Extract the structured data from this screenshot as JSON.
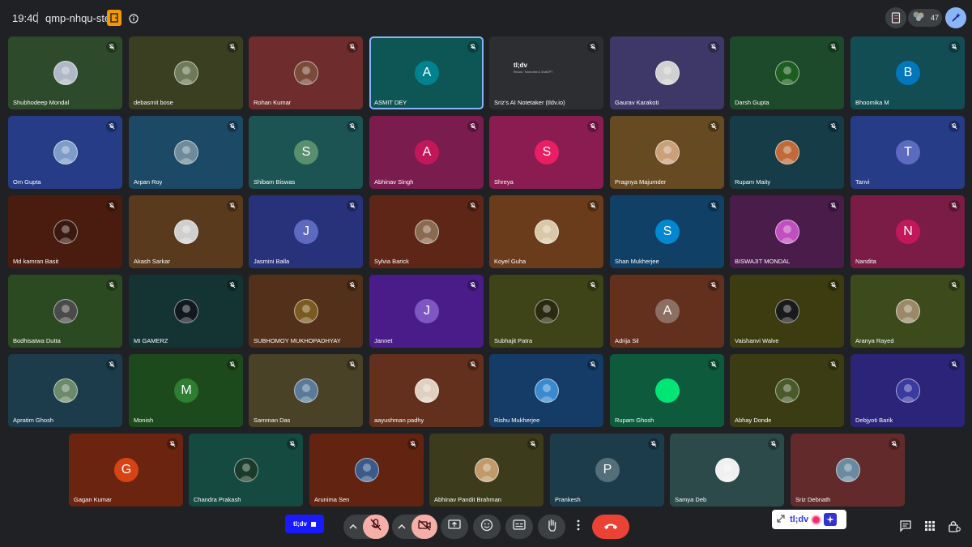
{
  "header": {
    "time": "19:40",
    "meeting_code": "qmp-nhqu-ste",
    "participant_count": "47",
    "icons": [
      "door-icon",
      "info-icon",
      "report-icon",
      "people-icon",
      "ai-sparkle-icon"
    ]
  },
  "participants": [
    {
      "name": "Shubhodeep Mondal",
      "bg": "#2d4a2a",
      "avatar": "photo",
      "avatar_color": "#b0b8c8"
    },
    {
      "name": "debasmit bose",
      "bg": "#3a3f22",
      "avatar": "photo",
      "avatar_color": "#6f7a5a"
    },
    {
      "name": "Rohan Kumar",
      "bg": "#6e2c2c",
      "avatar": "photo",
      "avatar_color": "#7a4a3a"
    },
    {
      "name": "ASMIT DEY",
      "bg": "#0e5555",
      "avatar": "letter",
      "initial": "A",
      "avatar_color": "#00838f",
      "active": true
    },
    {
      "name": "Sriz's AI Notetaker (tldv.io)",
      "bg": "#2d2e31",
      "avatar": "tldv",
      "tldv_logo": "tl;dv",
      "tldv_sub": "Record, Transcribe & ChatGPT"
    },
    {
      "name": "Gaurav Karakoti",
      "bg": "#3d3868",
      "avatar": "photo",
      "avatar_color": "#d0d0d0"
    },
    {
      "name": "Darsh Gupta",
      "bg": "#1e4a2c",
      "avatar": "photo",
      "avatar_color": "#1b5e20"
    },
    {
      "name": "Bhoomika M",
      "bg": "#114d52",
      "avatar": "letter",
      "initial": "B",
      "avatar_color": "#0277bd"
    },
    {
      "name": "Om Gupta",
      "bg": "#263c87",
      "avatar": "photo",
      "avatar_color": "#7f9cc8"
    },
    {
      "name": "Arpan Roy",
      "bg": "#1c4a66",
      "avatar": "photo",
      "avatar_color": "#6f8a9a"
    },
    {
      "name": "Shibam Biswas",
      "bg": "#1c5454",
      "avatar": "letter",
      "initial": "S",
      "avatar_color": "#598f6e"
    },
    {
      "name": "Abhinav Singh",
      "bg": "#7a1c4e",
      "avatar": "letter",
      "initial": "A",
      "avatar_color": "#c2185b"
    },
    {
      "name": "Shreya",
      "bg": "#8a1c52",
      "avatar": "letter",
      "initial": "S",
      "avatar_color": "#e91e63"
    },
    {
      "name": "Pragnya Majumder",
      "bg": "#654a22",
      "avatar": "photo",
      "avatar_color": "#c9a07a"
    },
    {
      "name": "Rupam Maity",
      "bg": "#153c47",
      "avatar": "photo",
      "avatar_color": "#c06a3a"
    },
    {
      "name": "Tanvi",
      "bg": "#263c87",
      "avatar": "letter",
      "initial": "T",
      "avatar_color": "#5c6bc0"
    },
    {
      "name": "Md kamran Basit",
      "bg": "#4a1c0f",
      "avatar": "photo",
      "avatar_color": "#3a1a10"
    },
    {
      "name": "Akash Sarkar",
      "bg": "#5a3a1c",
      "avatar": "photo",
      "avatar_color": "#cfcfcf"
    },
    {
      "name": "Jasmini Balla",
      "bg": "#28327a",
      "avatar": "letter",
      "initial": "J",
      "avatar_color": "#5c6bc0"
    },
    {
      "name": "Sylvia Barick",
      "bg": "#5e2616",
      "avatar": "photo",
      "avatar_color": "#8a6a50"
    },
    {
      "name": "Koyel Guha",
      "bg": "#6a3c1c",
      "avatar": "photo",
      "avatar_color": "#d8c8a8"
    },
    {
      "name": "Shan Mukherjee",
      "bg": "#114066",
      "avatar": "letter",
      "initial": "S",
      "avatar_color": "#0288d1"
    },
    {
      "name": "BISWAJIT MONDAL",
      "bg": "#4a1c4a",
      "avatar": "photo",
      "avatar_color": "#c050c0"
    },
    {
      "name": "Nandita",
      "bg": "#7a1c46",
      "avatar": "letter",
      "initial": "N",
      "avatar_color": "#c2185b"
    },
    {
      "name": "Bodhisatwa Dutta",
      "bg": "#2c4a22",
      "avatar": "photo",
      "avatar_color": "#4a4a4a"
    },
    {
      "name": "MI GAMERZ",
      "bg": "#143333",
      "avatar": "photo",
      "avatar_color": "#101820"
    },
    {
      "name": "SUBHOMOY MUKHOPADHYAY",
      "bg": "#52301a",
      "avatar": "photo",
      "avatar_color": "#7a5a20"
    },
    {
      "name": "Jannet",
      "bg": "#4a1c8a",
      "avatar": "letter",
      "initial": "J",
      "avatar_color": "#7e57c2"
    },
    {
      "name": "Subhajit Patra",
      "bg": "#3e4418",
      "avatar": "photo",
      "avatar_color": "#2a2a10"
    },
    {
      "name": "Adrija Sil",
      "bg": "#62301c",
      "avatar": "letter",
      "initial": "A",
      "avatar_color": "#8d6e63"
    },
    {
      "name": "Vaishanvi Walve",
      "bg": "#3c3c10",
      "avatar": "photo",
      "avatar_color": "#1a1a1a"
    },
    {
      "name": "Aranya Rayed",
      "bg": "#3c4a1c",
      "avatar": "photo",
      "avatar_color": "#9a8a6a"
    },
    {
      "name": "Apratim Ghosh",
      "bg": "#1c3c4c",
      "avatar": "photo",
      "avatar_color": "#6a8a6a"
    },
    {
      "name": "Monish",
      "bg": "#1c4a1c",
      "avatar": "letter",
      "initial": "M",
      "avatar_color": "#2e7d32"
    },
    {
      "name": "Samman Das",
      "bg": "#4a4226",
      "avatar": "photo",
      "avatar_color": "#5a7a9a"
    },
    {
      "name": "aayushman padhy",
      "bg": "#62301c",
      "avatar": "photo",
      "avatar_color": "#e0d0c0"
    },
    {
      "name": "Rishu Mukherjee",
      "bg": "#143c66",
      "avatar": "photo",
      "avatar_color": "#3a8ad0"
    },
    {
      "name": "Rupam Ghosh",
      "bg": "#0e5a3c",
      "avatar": "circle",
      "avatar_color": "#00e676"
    },
    {
      "name": "Abhay Donde",
      "bg": "#3c3c14",
      "avatar": "photo",
      "avatar_color": "#4a5a2a"
    },
    {
      "name": "Debjyoti Barik",
      "bg": "#2c2478",
      "avatar": "photo",
      "avatar_color": "#3a3aa0"
    },
    {
      "name": "Gagan Kumar",
      "bg": "#6a2410",
      "avatar": "letter",
      "initial": "G",
      "avatar_color": "#d84315"
    },
    {
      "name": "Chandra Prakash",
      "bg": "#144a40",
      "avatar": "photo",
      "avatar_color": "#1a3a2a"
    },
    {
      "name": "Arunima Sen",
      "bg": "#622410",
      "avatar": "photo",
      "avatar_color": "#3a5a8a"
    },
    {
      "name": "Abhinav Pandit Brahman",
      "bg": "#3c3c1c",
      "avatar": "photo",
      "avatar_color": "#c09a6a"
    },
    {
      "name": "Prankesh",
      "bg": "#1c3c4c",
      "avatar": "letter",
      "initial": "P",
      "avatar_color": "#546e7a"
    },
    {
      "name": "Samya Deb",
      "bg": "#2c4a4a",
      "avatar": "photo",
      "avatar_color": "#f0f0f0"
    },
    {
      "name": "Sriz Debnath",
      "bg": "#622a2a",
      "avatar": "photo",
      "avatar_color": "#6a8aa0"
    }
  ],
  "controls": {
    "tldv_chip": "tl;dv",
    "extension_label": "tl;dv",
    "icons": [
      "chevron-up-icon",
      "mic-off-icon",
      "camera-off-icon",
      "present-icon",
      "emoji-icon",
      "captions-icon",
      "raise-hand-icon",
      "more-icon",
      "end-call-icon",
      "chat-icon",
      "activities-icon",
      "host-controls-icon"
    ]
  },
  "colors": {
    "background": "#202124",
    "control": "#3c4043",
    "muted_control": "#f6aea9",
    "end_call": "#ea4335",
    "tldv_blue": "#1a1aff",
    "active_border": "#8ab4f8"
  }
}
